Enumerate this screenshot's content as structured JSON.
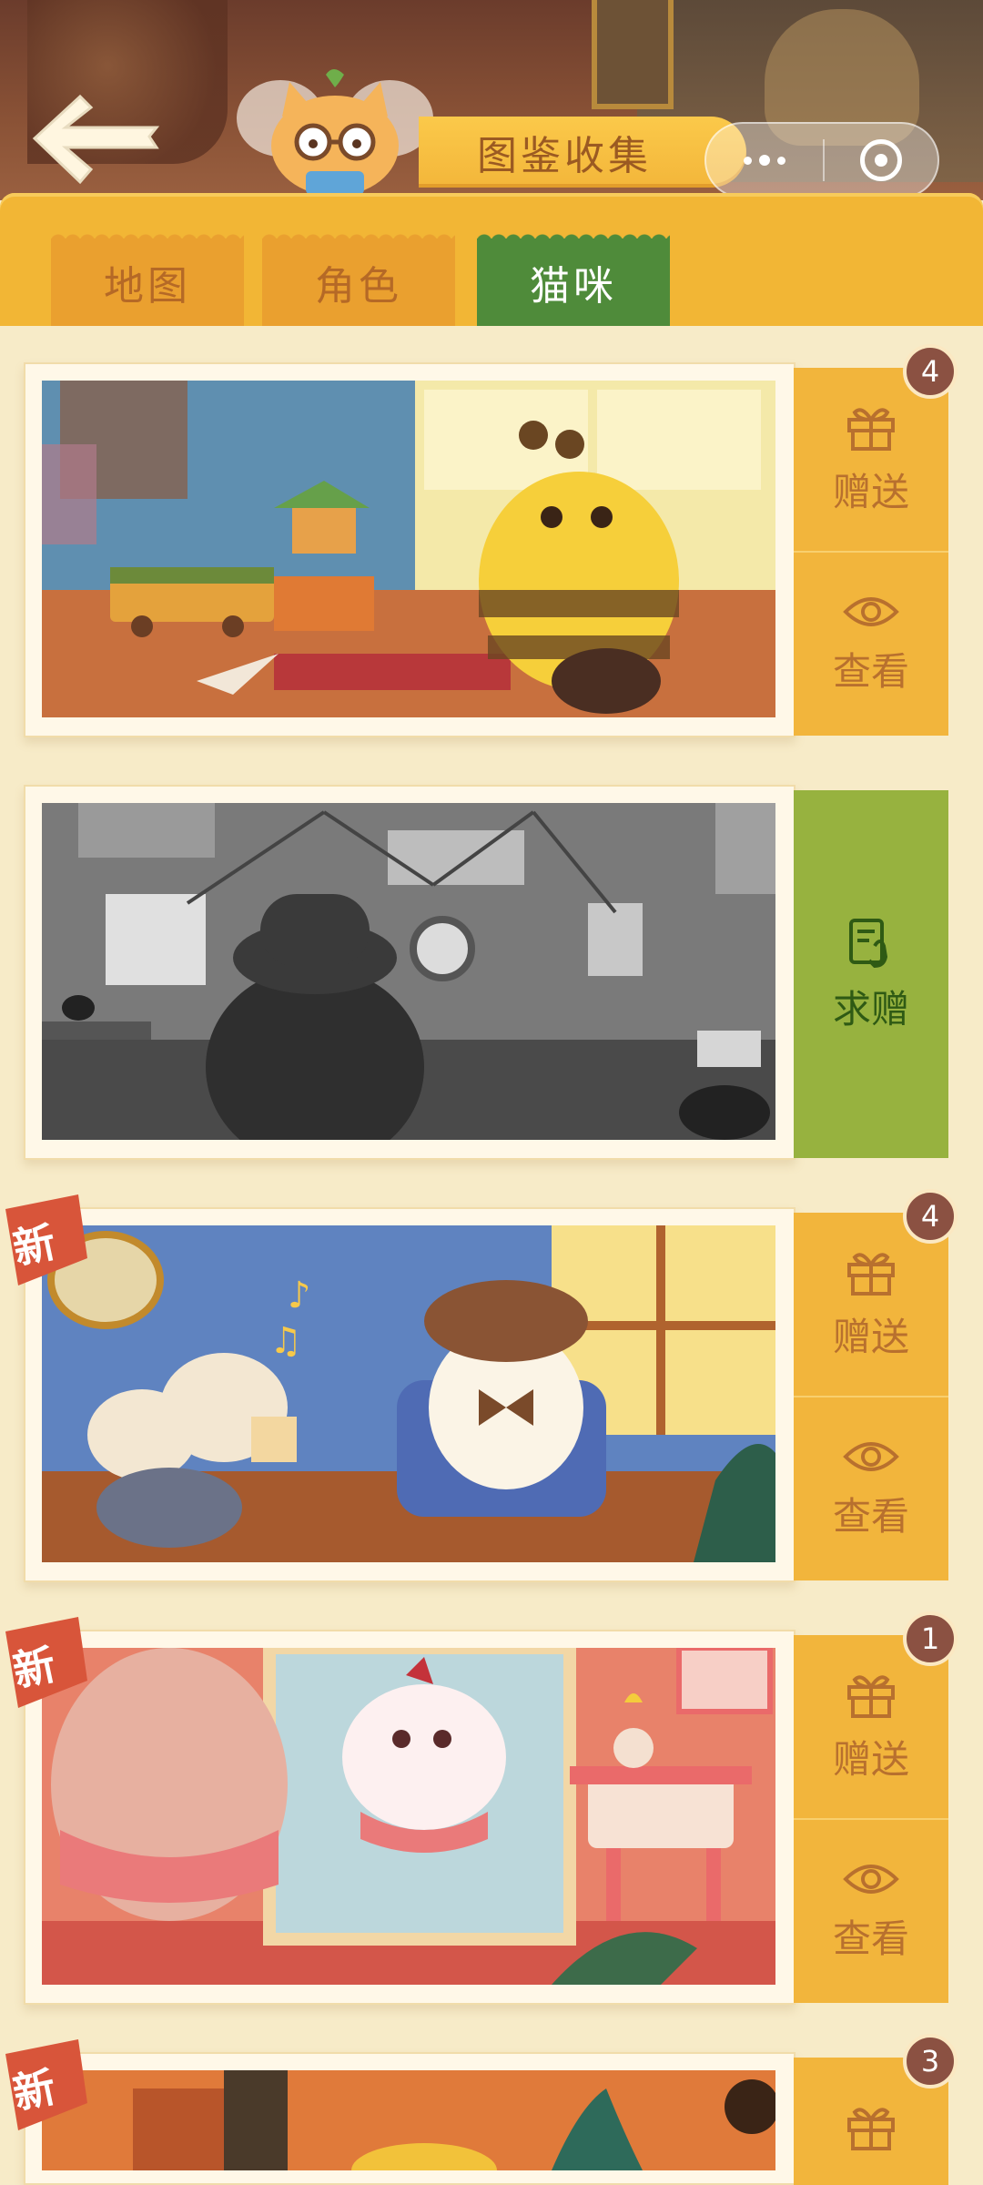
{
  "header": {
    "title": "图鉴收集"
  },
  "tabs": [
    {
      "label": "地图",
      "active": false
    },
    {
      "label": "角色",
      "active": false
    },
    {
      "label": "猫咪",
      "active": true
    }
  ],
  "cards": [
    {
      "badge": "4",
      "is_new": false,
      "actions": [
        "赠送",
        "查看"
      ],
      "owned": true
    },
    {
      "badge": "",
      "is_new": false,
      "actions": [
        "求赠"
      ],
      "owned": false
    },
    {
      "badge": "4",
      "is_new": true,
      "actions": [
        "赠送",
        "查看"
      ],
      "owned": true
    },
    {
      "badge": "1",
      "is_new": true,
      "actions": [
        "赠送",
        "查看"
      ],
      "owned": true
    },
    {
      "badge": "3",
      "is_new": true,
      "actions": [
        "赠送"
      ],
      "owned": true
    }
  ],
  "new_tag_label": "新",
  "colors": {
    "tab_active": "#4f8b3a",
    "tab_inactive": "#eaa02f",
    "action_bg": "#f2b53c",
    "request_bg": "#97b23f",
    "badge": "#8b5142"
  }
}
